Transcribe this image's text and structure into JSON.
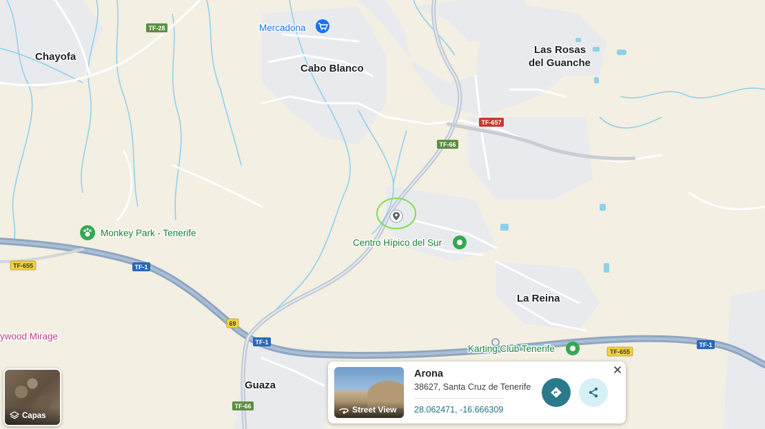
{
  "map": {
    "places": [
      {
        "id": "chayofa",
        "label": "Chayofa"
      },
      {
        "id": "cabo-blanco",
        "label": "Cabo Blanco"
      },
      {
        "id": "las-rosas-1",
        "label": "Las Rosas"
      },
      {
        "id": "las-rosas-2",
        "label": "del Guanche"
      },
      {
        "id": "la-reina",
        "label": "La Reina"
      },
      {
        "id": "guaza",
        "label": "Guaza"
      }
    ],
    "pois": [
      {
        "id": "mercadona",
        "label": "Mercadona",
        "color": "#1a73e8"
      },
      {
        "id": "monkey-park",
        "label": "Monkey Park - Tenerife",
        "color": "#188038"
      },
      {
        "id": "centro-hipico",
        "label": "Centro Hípico del Sur",
        "color": "#188038"
      },
      {
        "id": "karting",
        "label": "Karting Club Tenerife",
        "color": "#188038"
      },
      {
        "id": "wood-mirage",
        "label": "ywood Mirage",
        "color": "#c5378e"
      }
    ],
    "road_shields": [
      {
        "id": "tf28",
        "label": "TF-28",
        "kind": "green"
      },
      {
        "id": "tf657",
        "label": "TF-657",
        "kind": "red"
      },
      {
        "id": "tf66-north",
        "label": "TF-66",
        "kind": "green"
      },
      {
        "id": "tf655-west",
        "label": "TF-655",
        "kind": "yellow"
      },
      {
        "id": "tf1-west",
        "label": "TF-1",
        "kind": "blue"
      },
      {
        "id": "exit-69",
        "label": "69",
        "kind": "yellow"
      },
      {
        "id": "tf1-mid",
        "label": "TF-1",
        "kind": "blue"
      },
      {
        "id": "tf1-east",
        "label": "TF-1",
        "kind": "blue"
      },
      {
        "id": "tf655-east",
        "label": "TF-655",
        "kind": "yellow"
      },
      {
        "id": "tf66-south",
        "label": "TF-66",
        "kind": "green"
      }
    ],
    "colors": {
      "land": "#f3efe2",
      "urban": "#e9eaee",
      "minor_road": "#ffffff",
      "highway": "#8fa6c1",
      "water": "#8ed1ec",
      "highlight_circle": "#7ee04d"
    }
  },
  "layers_control": {
    "label": "Capas",
    "icon": "layers-icon"
  },
  "place_card": {
    "title": "Arona",
    "address": "38627, Santa Cruz de Tenerife",
    "coordinates": "28.062471, -16.666309",
    "street_view_label": "Street View",
    "directions_icon": "directions-icon",
    "share_icon": "share-icon",
    "close_icon": "close-icon"
  }
}
